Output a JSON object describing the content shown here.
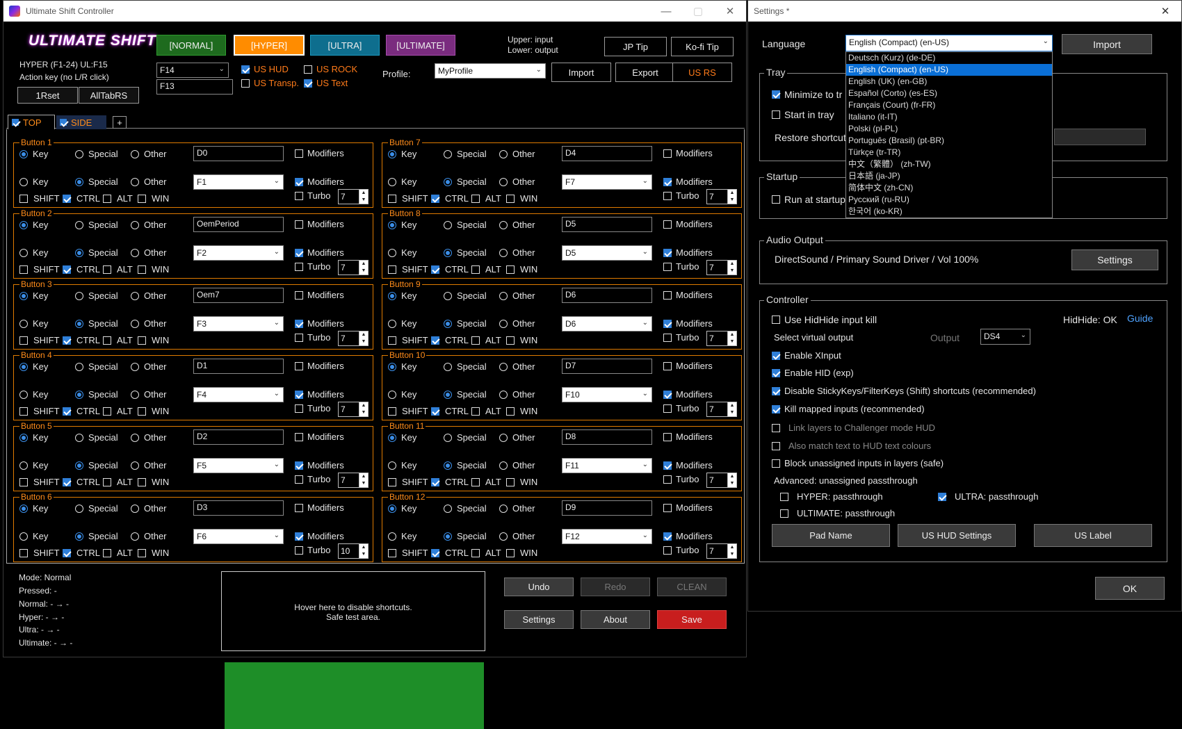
{
  "main": {
    "title": "Ultimate Shift Controller",
    "logo": "ULTIMATE SHIFT",
    "mode_buttons": [
      "[NORMAL]",
      "[HYPER]",
      "[ULTRA]",
      "[ULTIMATE]"
    ],
    "mode_colors": {
      "normal": "#1e6b1e",
      "hyper": "#ff8c00",
      "ultra": "#0e6e8e",
      "ultimate": "#7a2c7f"
    },
    "info1": "HYPER (F1-24) UL:F15",
    "info2": "Action key (no L/R click)",
    "btn_1rset": "1Rset",
    "btn_alltab": "AllTabRS",
    "key_select": "F14",
    "key_input": "F13",
    "chk": {
      "us_hud": "US HUD",
      "us_rock": "US ROCK",
      "us_transp": "US Transp.",
      "us_text": "US Text"
    },
    "upper": "Upper: input",
    "lower": "Lower: output",
    "jp_tip": "JP Tip",
    "kofi_tip": "Ko-fi Tip",
    "profile_label": "Profile:",
    "profile_value": "MyProfile",
    "import": "Import",
    "export": "Export",
    "us_rs": "US RS",
    "tabs": [
      "TOP",
      "SIDE"
    ],
    "tab_add": "+",
    "labels": {
      "key": "Key",
      "special": "Special",
      "other": "Other",
      "modifiers": "Modifiers",
      "turbo": "Turbo",
      "shift": "SHIFT",
      "ctrl": "CTRL",
      "alt": "ALT",
      "win": "WIN"
    },
    "buttons": [
      {
        "name": "Button 1",
        "in": "D0",
        "out": "F1",
        "turbo": "7"
      },
      {
        "name": "Button 2",
        "in": "OemPeriod",
        "out": "F2",
        "turbo": "7"
      },
      {
        "name": "Button 3",
        "in": "Oem7",
        "out": "F3",
        "turbo": "7"
      },
      {
        "name": "Button 4",
        "in": "D1",
        "out": "F4",
        "turbo": "7"
      },
      {
        "name": "Button 5",
        "in": "D2",
        "out": "F5",
        "turbo": "7"
      },
      {
        "name": "Button 6",
        "in": "D3",
        "out": "F6",
        "turbo": "10"
      },
      {
        "name": "Button 7",
        "in": "D4",
        "out": "F7",
        "turbo": "7"
      },
      {
        "name": "Button 8",
        "in": "D5",
        "out": "D5",
        "turbo": "7"
      },
      {
        "name": "Button 9",
        "in": "D6",
        "out": "D6",
        "turbo": "7"
      },
      {
        "name": "Button 10",
        "in": "D7",
        "out": "F10",
        "turbo": "7"
      },
      {
        "name": "Button 11",
        "in": "D8",
        "out": "F11",
        "turbo": "7"
      },
      {
        "name": "Button 12",
        "in": "D9",
        "out": "F12",
        "turbo": "7"
      }
    ],
    "status": [
      "Mode: Normal",
      "Pressed: -",
      "Normal: - → -",
      "Hyper:  - → -",
      "Ultra:  - → -",
      "Ultimate: - → -"
    ],
    "hover1": "Hover here to disable shortcuts.",
    "hover2": "Safe test area.",
    "undo": "Undo",
    "redo": "Redo",
    "clean": "CLEAN",
    "settings": "Settings",
    "about": "About",
    "save": "Save"
  },
  "settings": {
    "title": "Settings *",
    "language_label": "Language",
    "language_value": "English (Compact) (en-US)",
    "import": "Import",
    "languages": [
      "Deutsch (Kurz) (de-DE)",
      "English (Compact) (en-US)",
      "English (UK) (en-GB)",
      "Español (Corto) (es-ES)",
      "Français (Court) (fr-FR)",
      "Italiano (it-IT)",
      "Polski (pl-PL)",
      "Português (Brasil) (pt-BR)",
      "Türkçe (tr-TR)",
      "中文（繁體） (zh-TW)",
      "日本語 (ja-JP)",
      "简体中文 (zh-CN)",
      "Русский (ru-RU)",
      "한국어 (ko-KR)"
    ],
    "tray": "Tray",
    "minimize": "Minimize to tr",
    "start_tray": "Start in tray",
    "restore": "Restore shortcut",
    "startup": "Startup",
    "run_startup": "Run at startup",
    "audio": "Audio Output",
    "audio_value": "DirectSound / Primary Sound Driver / Vol 100%",
    "audio_settings": "Settings",
    "controller": "Controller",
    "hidhide": "Use HidHide input kill",
    "hidhide_ok": "HidHide: OK",
    "guide": "Guide",
    "virtual": "Select virtual output",
    "output_label": "Output",
    "output_value": "DS4",
    "xinput": "Enable XInput",
    "hid": "Enable HID (exp)",
    "sticky": "Disable StickyKeys/FilterKeys (Shift) shortcuts (recommended)",
    "kill": "Kill mapped inputs (recommended)",
    "link": "Link layers to Challenger mode HUD",
    "match": "Also match text to HUD text colours",
    "block": "Block unassigned inputs in layers (safe)",
    "advanced": "Advanced: unassigned passthrough",
    "hyper_pass": "HYPER: passthrough",
    "ultra_pass": "ULTRA: passthrough",
    "ultimate_pass": "ULTIMATE: passthrough",
    "pad_name": "Pad Name",
    "us_hud_settings": "US HUD Settings",
    "us_label": "US Label",
    "ok": "OK"
  }
}
